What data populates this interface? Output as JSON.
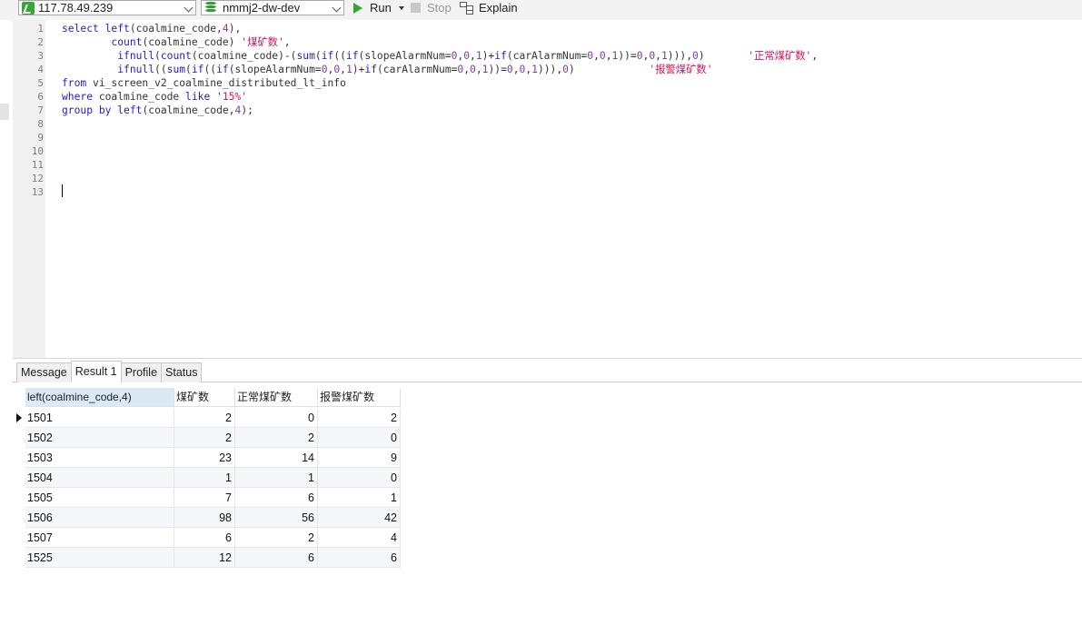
{
  "toolbar": {
    "connection": "117.78.49.239",
    "database": "nmmj2-dw-dev",
    "run_label": "Run",
    "stop_label": "Stop",
    "explain_label": "Explain"
  },
  "editor": {
    "line_numbers": [
      "1",
      "2",
      "3",
      "4",
      "5",
      "6",
      "7",
      "8",
      "9",
      "10",
      "11",
      "12",
      "13"
    ]
  },
  "result": {
    "tabs": [
      "Message",
      "Result 1",
      "Profile",
      "Status"
    ],
    "active_tab": "Result 1",
    "columns": [
      "left(coalmine_code,4)",
      "煤矿数",
      "正常煤矿数",
      "报警煤矿数"
    ],
    "rows": [
      [
        "1501",
        "2",
        "0",
        "2"
      ],
      [
        "1502",
        "2",
        "2",
        "0"
      ],
      [
        "1503",
        "23",
        "14",
        "9"
      ],
      [
        "1504",
        "1",
        "1",
        "0"
      ],
      [
        "1505",
        "7",
        "6",
        "1"
      ],
      [
        "1506",
        "98",
        "56",
        "42"
      ],
      [
        "1507",
        "6",
        "2",
        "4"
      ],
      [
        "1525",
        "12",
        "6",
        "6"
      ]
    ]
  },
  "colors": {
    "keyword": "#1d1dd4",
    "string": "#d4145a",
    "number": "#7a3ea0",
    "run_green": "#33a532",
    "header_selected": "#dbe9f7"
  }
}
